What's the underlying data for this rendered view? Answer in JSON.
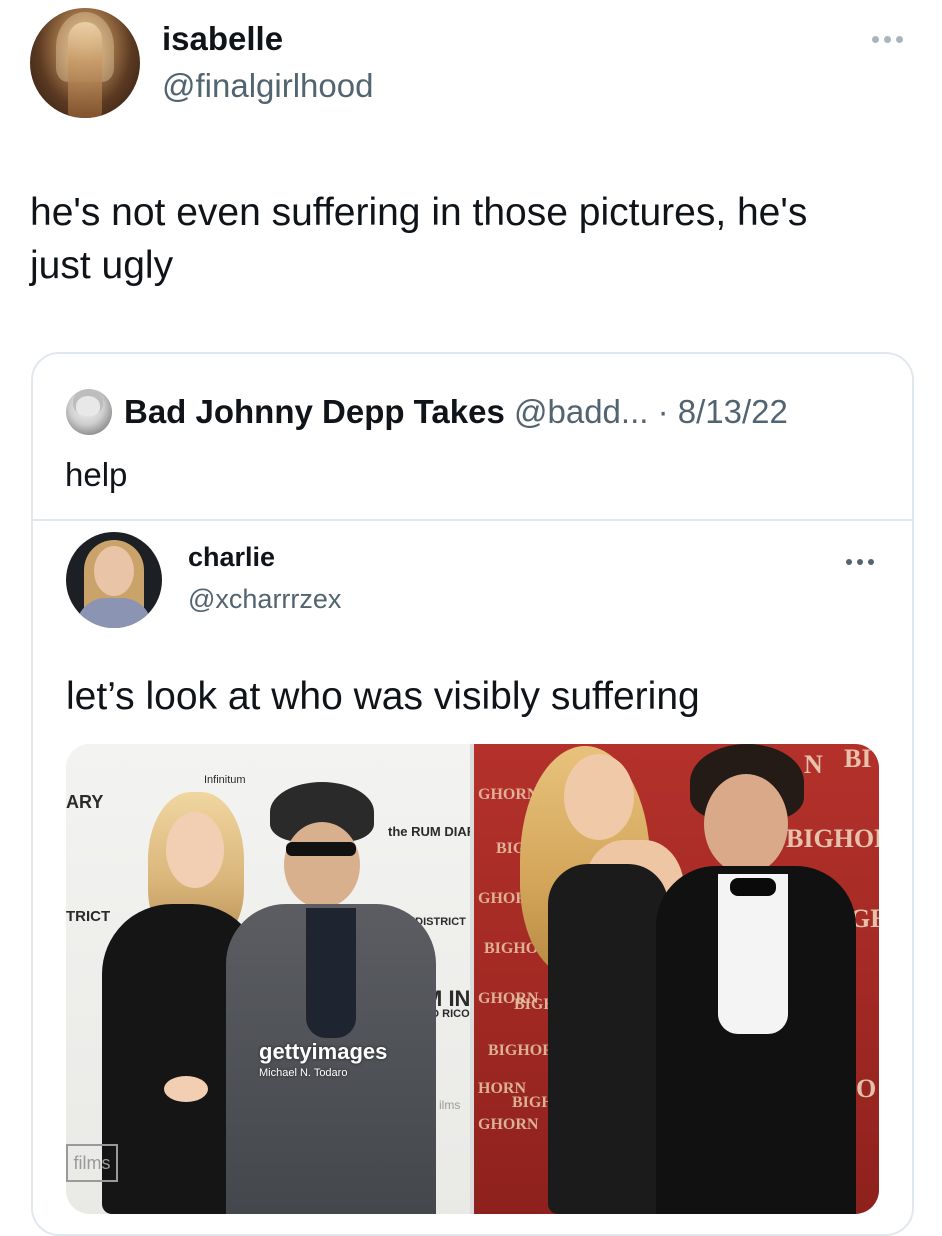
{
  "tweet": {
    "author": {
      "display_name": "isabelle",
      "handle": "@finalgirlhood"
    },
    "text": "he's not even suffering in those pictures, he's\njust ugly",
    "more_icon": "more-horizontal-icon"
  },
  "quoted_tweet": {
    "author": {
      "display_name": "Bad Johnny Depp Takes",
      "handle": "@badd...",
      "separator": " · ",
      "date": "8/13/22"
    },
    "text": "help",
    "embedded": {
      "author": {
        "display_name": "charlie",
        "handle": "@xcharrrzex"
      },
      "text": "let’s look at who was visibly suffering",
      "more_icon": "more-horizontal-icon",
      "photos": {
        "left": {
          "backdrop": [
            "ARY",
            "TRICT",
            "Infinitum",
            "the RUM DIARY",
            "MDISTRICT",
            "M IN",
            "TO RICO",
            "films",
            "ilms"
          ],
          "watermark_brand": "gettyimages",
          "watermark_credit": "Michael N. Todaro"
        },
        "right": {
          "backdrop": [
            "GHORN",
            "BIGHORN",
            "BIGHOR",
            "GHORN",
            "BIGHO",
            "GHORN",
            "BIGHO",
            "BIGHORN",
            "HORN",
            "BIGH",
            "GHORN",
            "N",
            "BI",
            "GH",
            "O"
          ]
        }
      }
    }
  },
  "colors": {
    "text_primary": "#0f1419",
    "text_secondary": "#536471",
    "border": "#e1e8ed",
    "backdrop_red": "#a52a25"
  }
}
